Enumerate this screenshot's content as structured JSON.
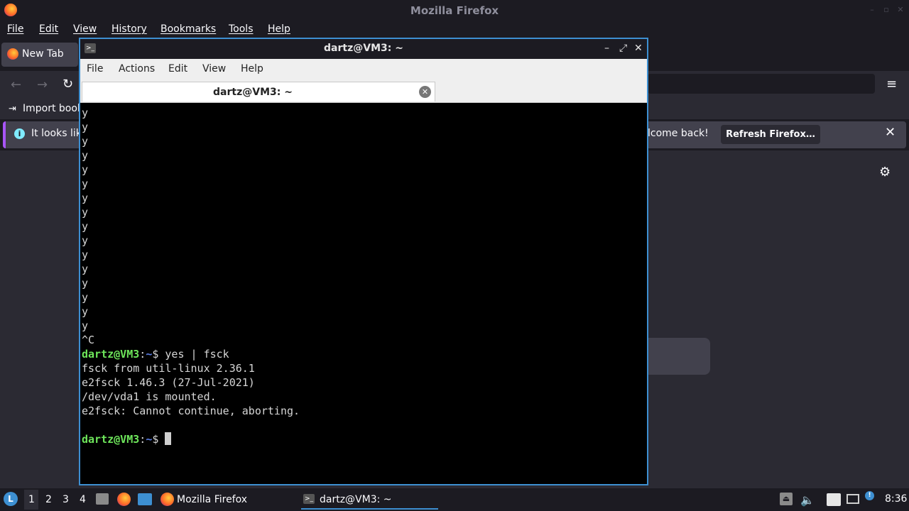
{
  "firefox": {
    "title": "Mozilla Firefox",
    "menu": [
      "File",
      "Edit",
      "View",
      "History",
      "Bookmarks",
      "Tools",
      "Help"
    ],
    "tab_label": "New Tab",
    "bookmarks_label": "Import book",
    "info_text": "It looks lik",
    "info_welcome": "lcome back!",
    "refresh_button": "Refresh Firefox…"
  },
  "terminal": {
    "title": "dartz@VM3: ~",
    "menu": [
      "File",
      "Actions",
      "Edit",
      "View",
      "Help"
    ],
    "tab_label": "dartz@VM3: ~",
    "output_lines": [
      "y",
      "y",
      "y",
      "y",
      "y",
      "y",
      "y",
      "y",
      "y",
      "y",
      "y",
      "y",
      "y",
      "y",
      "y",
      "y",
      "^C"
    ],
    "prompt_user": "dartz@VM3",
    "prompt_sep": ":",
    "prompt_path": "~",
    "prompt_symbol": "$",
    "command": "yes | fsck",
    "command_output": [
      "fsck from util-linux 2.36.1",
      "e2fsck 1.46.3 (27-Jul-2021)",
      "/dev/vda1 is mounted.",
      "e2fsck: Cannot continue, aborting."
    ]
  },
  "taskbar": {
    "workspaces": [
      "1",
      "2",
      "3",
      "4"
    ],
    "firefox_task": "Mozilla Firefox",
    "terminal_task": "dartz@VM3: ~",
    "clock": "8:36"
  }
}
